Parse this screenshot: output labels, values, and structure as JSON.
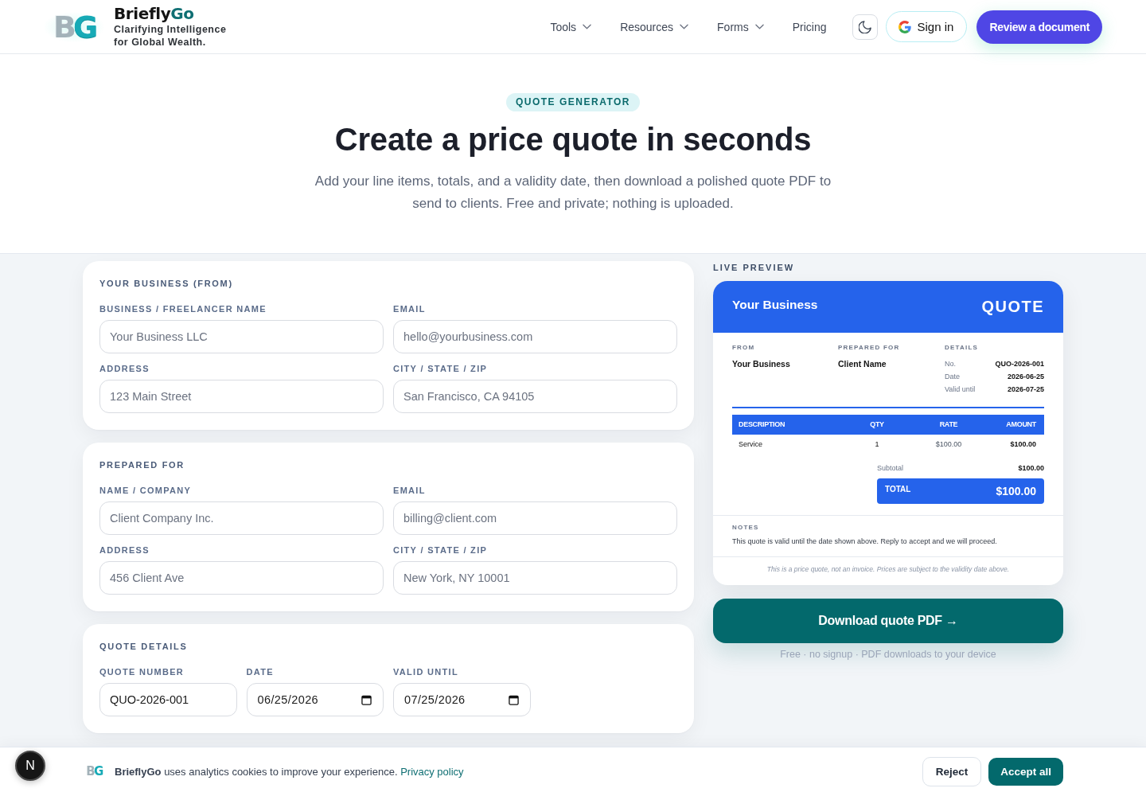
{
  "header": {
    "logo": {
      "mark_left": "B",
      "mark_right": "G",
      "name": "Briefly",
      "name_accent": "Go",
      "tagline": "Clarifying Intelligence for Global Wealth."
    },
    "nav": [
      {
        "label": "Tools",
        "kind": "dropdown"
      },
      {
        "label": "Resources",
        "kind": "dropdown"
      },
      {
        "label": "Forms",
        "kind": "dropdown"
      },
      {
        "label": "Pricing",
        "kind": "link"
      }
    ],
    "sign_in": "Sign in",
    "cta": "Review a document"
  },
  "hero": {
    "tag": "QUOTE GENERATOR",
    "title": "Create a price quote in seconds",
    "subtitle": "Add your line items, totals, and a validity date, then download a polished quote PDF to send to clients. Free and private; nothing is uploaded."
  },
  "form_sections": [
    {
      "title": "YOUR BUSINESS (FROM)",
      "kind": "contact",
      "fields": [
        {
          "label": "BUSINESS / FREELANCER NAME",
          "kind": "text",
          "placeholder": "Your Business LLC"
        },
        {
          "label": "EMAIL",
          "kind": "text",
          "placeholder": "hello@yourbusiness.com"
        },
        {
          "label": "ADDRESS",
          "kind": "text",
          "placeholder": "123 Main Street"
        },
        {
          "label": "CITY / STATE / ZIP",
          "kind": "text",
          "placeholder": "San Francisco, CA 94105"
        }
      ]
    },
    {
      "title": "PREPARED FOR",
      "kind": "contact",
      "fields": [
        {
          "label": "NAME / COMPANY",
          "kind": "text",
          "placeholder": "Client Company Inc."
        },
        {
          "label": "EMAIL",
          "kind": "text",
          "placeholder": "billing@client.com"
        },
        {
          "label": "ADDRESS",
          "kind": "text",
          "placeholder": "456 Client Ave"
        },
        {
          "label": "CITY / STATE / ZIP",
          "kind": "text",
          "placeholder": "New York, NY 10001"
        }
      ]
    },
    {
      "title": "QUOTE DETAILS",
      "kind": "details",
      "fields": [
        {
          "label": "QUOTE NUMBER",
          "kind": "text",
          "value": "QUO-2026-001"
        },
        {
          "label": "DATE",
          "kind": "date",
          "value": "06/25/2026"
        },
        {
          "label": "VALID UNTIL",
          "kind": "date",
          "value": "07/25/2026"
        }
      ]
    }
  ],
  "preview": {
    "label": "LIVE PREVIEW",
    "business": "Your Business",
    "document_title": "QUOTE",
    "parties": [
      {
        "label": "FROM",
        "value": "Your Business"
      },
      {
        "label": "PREPARED FOR",
        "value": "Client Name"
      }
    ],
    "details_label": "DETAILS",
    "details": [
      {
        "label": "No.",
        "value": "QUO-2026-001"
      },
      {
        "label": "Date",
        "value": "2026-06-25"
      },
      {
        "label": "Valid until",
        "value": "2026-07-25"
      }
    ],
    "table": {
      "columns": [
        "DESCRIPTION",
        "QTY",
        "RATE",
        "AMOUNT"
      ],
      "rows": [
        [
          "Service",
          "1",
          "$100.00",
          "$100.00"
        ]
      ]
    },
    "subtotal": {
      "label": "Subtotal",
      "value": "$100.00"
    },
    "total": {
      "label": "TOTAL",
      "value": "$100.00"
    },
    "notes": {
      "label": "NOTES",
      "text": "This quote is valid until the date shown above. Reply to accept and we will proceed."
    },
    "disclaimer": "This is a price quote, not an invoice. Prices are subject to the validity date above."
  },
  "download": {
    "label": "Download quote PDF →",
    "caption": "Free · no signup · PDF downloads to your device"
  },
  "cookie_banner": {
    "mark_left": "B",
    "mark_right": "G",
    "text": "**BrieflyGo** uses analytics cookies to improve your experience.",
    "link": "Privacy policy",
    "buttons": [
      {
        "label": "Reject",
        "kind": "secondary"
      },
      {
        "label": "Accept all",
        "kind": "primary"
      }
    ]
  },
  "dev_badge": "N"
}
